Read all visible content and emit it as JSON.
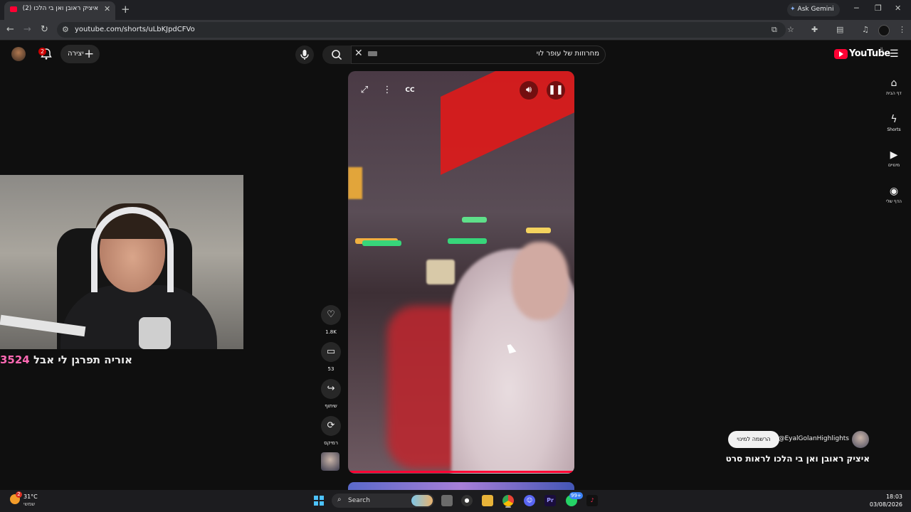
{
  "browser": {
    "tab_title": "איציק ראובן ואן בי הלכו (2)",
    "url": "youtube.com/shorts/uLbKJpdCFVo",
    "ask_gemini": "Ask Gemini"
  },
  "youtube": {
    "create_label": "יצירה",
    "notification_count": "2",
    "search_query": "מחרוזות של עופר לוי",
    "logo_text": "YouTube",
    "country_code": "IL",
    "nav": [
      {
        "label": "דף הבית",
        "icon": "home-icon"
      },
      {
        "label": "Shorts",
        "icon": "shorts-icon"
      },
      {
        "label": "מינויים",
        "icon": "subscriptions-icon"
      },
      {
        "label": "הדף שלי",
        "icon": "you-icon"
      }
    ],
    "actions": {
      "likes": "1.8K",
      "comments": "53",
      "share": "שיתוף",
      "remix": "רמיקס"
    },
    "channel": {
      "handle": "@EyalGolanHighlights",
      "subscribe": "הרשמה למינוי"
    },
    "short_title": "איציק ראובן ואן בי הלכו לראות סרט"
  },
  "overlay": {
    "donation_number": "3524",
    "donation_text": "אוריה תפרגן לי אבל"
  },
  "taskbar": {
    "temperature": "31°C",
    "weather": "שמשי",
    "search_label": "Search",
    "badge_weather": "2",
    "badge_whatsapp": "99+",
    "time": "18:03",
    "date": "03/08/2026"
  },
  "colors": {
    "youtube_red": "#ff0033",
    "background": "#0f0f0f",
    "donation_pink": "#ff69b4"
  }
}
